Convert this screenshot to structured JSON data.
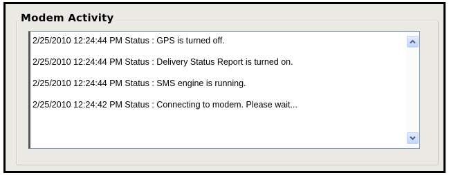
{
  "panel": {
    "title": "Modem Activity"
  },
  "log": {
    "entries": [
      "2/25/2010 12:24:44 PM Status : GPS is turned off.",
      "2/25/2010 12:24:44 PM Status : Delivery Status Report is turned on.",
      "2/25/2010 12:24:44 PM Status : SMS engine is running.",
      "2/25/2010 12:24:42 PM Status : Connecting to modem. Please wait..."
    ]
  },
  "icons": {
    "scroll_up": "chevron-up-icon",
    "scroll_down": "chevron-down-icon"
  },
  "colors": {
    "panel_background": "#ebe9e4",
    "frame_border": "#000000",
    "listbox_border": "#7f9db9",
    "scroll_arrow": "#4d6185"
  }
}
